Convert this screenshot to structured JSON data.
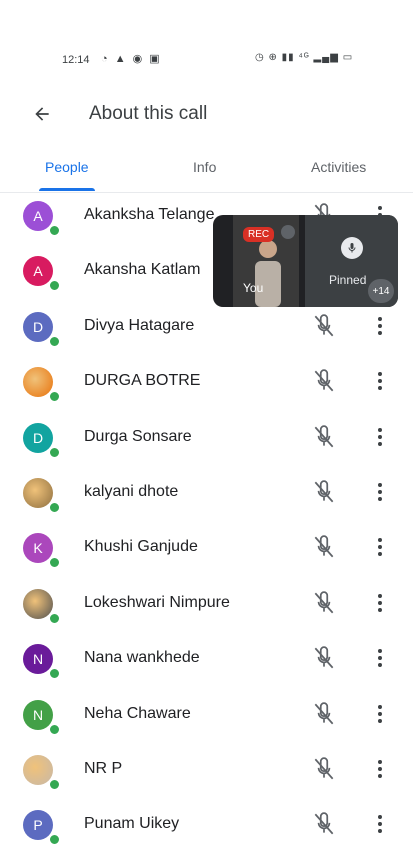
{
  "status_bar": {
    "time": "12:14",
    "left_icons": "◔ ▲ ◉ ▣",
    "right_icons": "◷ ⊕ ▮▮ ⁴ᴳ ▂▄▆ ▭"
  },
  "header": {
    "title": "About this call"
  },
  "tabs": [
    {
      "label": "People",
      "active": true
    },
    {
      "label": "Info",
      "active": false
    },
    {
      "label": "Activities",
      "active": false
    }
  ],
  "participants": [
    {
      "name": "Akanksha Telange",
      "initial": "A",
      "color": "#9c4fd6"
    },
    {
      "name": "Akansha Katlam",
      "initial": "A",
      "color": "#d81b60"
    },
    {
      "name": "Divya Hatagare",
      "initial": "D",
      "color": "#5c6bc0"
    },
    {
      "name": "DURGA BOTRE",
      "initial": "",
      "color": "#e8710a",
      "photo": true
    },
    {
      "name": "Durga Sonsare",
      "initial": "D",
      "color": "#12a4a0"
    },
    {
      "name": "kalyani dhote",
      "initial": "",
      "color": "#8d6e3f",
      "photo": true
    },
    {
      "name": "Khushi Ganjude",
      "initial": "K",
      "color": "#ab47bc"
    },
    {
      "name": "Lokeshwari Nimpure",
      "initial": "",
      "color": "#4e4e4e",
      "photo": true
    },
    {
      "name": "Nana wankhede",
      "initial": "N",
      "color": "#6a1b9a"
    },
    {
      "name": "Neha Chaware",
      "initial": "N",
      "color": "#43a047"
    },
    {
      "name": "NR P",
      "initial": "",
      "color": "#c7b8a8",
      "photo": true
    },
    {
      "name": "Punam Uikey",
      "initial": "P",
      "color": "#5c6bc0"
    }
  ],
  "pip": {
    "rec_label": "REC",
    "you_label": "You",
    "pinned_label": "Pinned",
    "count_label": "+14"
  }
}
